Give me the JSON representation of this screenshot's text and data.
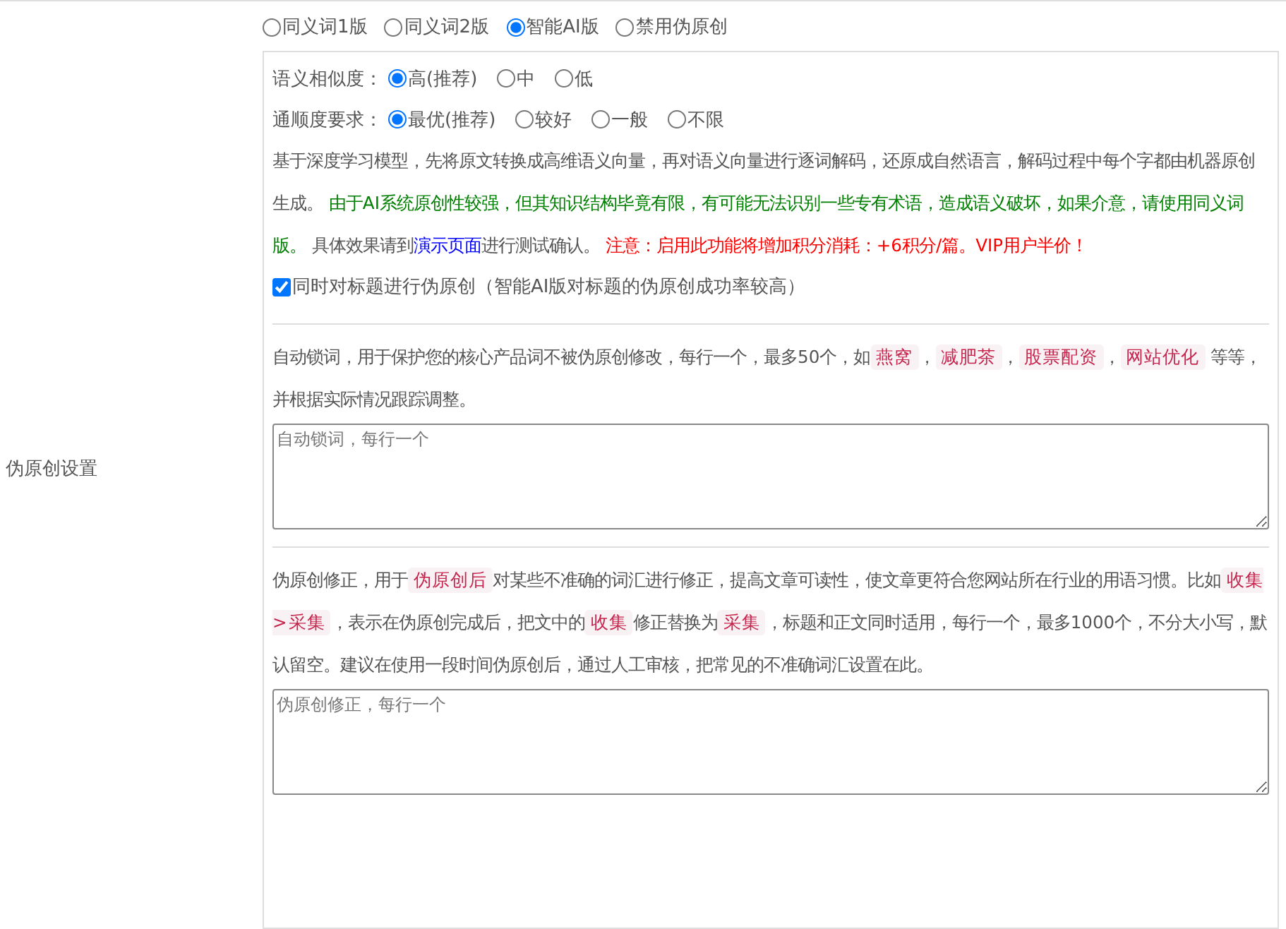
{
  "setting_label": "伪原创设置",
  "modes": [
    {
      "label": "同义词1版",
      "selected": false
    },
    {
      "label": "同义词2版",
      "selected": false
    },
    {
      "label": "智能AI版",
      "selected": true
    },
    {
      "label": "禁用伪原创",
      "selected": false
    }
  ],
  "similarity": {
    "label": "语义相似度：",
    "options": [
      {
        "label": "高(推荐)",
        "selected": true
      },
      {
        "label": "中",
        "selected": false
      },
      {
        "label": "低",
        "selected": false
      }
    ]
  },
  "fluency": {
    "label": "通顺度要求：",
    "options": [
      {
        "label": "最优(推荐)",
        "selected": true
      },
      {
        "label": "较好",
        "selected": false
      },
      {
        "label": "一般",
        "selected": false
      },
      {
        "label": "不限",
        "selected": false
      }
    ]
  },
  "ai_description": [
    {
      "kind": "plain",
      "text": "基于深度学习模型，先将原文转换成高维语义向量，再对语义向量进行逐词解码，还原成自然语言，解码过程中每个字都由机器原创生成。 "
    },
    {
      "kind": "green",
      "text": "由于AI系统原创性较强，但其知识结构毕竟有限，有可能无法识别一些专有术语，造成语义破坏，如果介意，请使用同义词版。"
    },
    {
      "kind": "plain",
      "text": " 具体效果请到"
    },
    {
      "kind": "link",
      "text": "演示页面"
    },
    {
      "kind": "plain",
      "text": "进行测试确认。 "
    },
    {
      "kind": "red",
      "text": "注意：启用此功能将增加积分消耗：+6积分/篇。VIP用户半价！"
    }
  ],
  "title_option": {
    "label": "同时对标题进行伪原创（智能AI版对标题的伪原创成功率较高）",
    "checked": true
  },
  "lock_words": {
    "description": [
      {
        "kind": "plain",
        "text": "自动锁词，用于保护您的核心产品词不被伪原创修改，每行一个，最多50个，如"
      },
      {
        "kind": "tag",
        "text": "燕窝"
      },
      {
        "kind": "plain",
        "text": "，"
      },
      {
        "kind": "tag",
        "text": "减肥茶"
      },
      {
        "kind": "plain",
        "text": "，"
      },
      {
        "kind": "tag",
        "text": "股票配资"
      },
      {
        "kind": "plain",
        "text": "，"
      },
      {
        "kind": "tag",
        "text": "网站优化"
      },
      {
        "kind": "plain",
        "text": " 等等，并根据实际情况跟踪调整。"
      }
    ],
    "placeholder": "自动锁词，每行一个"
  },
  "correction": {
    "description": [
      {
        "kind": "plain",
        "text": "伪原创修正，用于"
      },
      {
        "kind": "tag",
        "text": "伪原创后"
      },
      {
        "kind": "plain",
        "text": "对某些不准确的词汇进行修正，提高文章可读性，使文章更符合您网站所在行业的用语习惯。比如"
      },
      {
        "kind": "tag",
        "text": "收集>采集"
      },
      {
        "kind": "plain",
        "text": "，表示在伪原创完成后，把文中的"
      },
      {
        "kind": "tag",
        "text": "收集"
      },
      {
        "kind": "plain",
        "text": "修正替换为"
      },
      {
        "kind": "tag",
        "text": "采集"
      },
      {
        "kind": "plain",
        "text": "，标题和正文同时适用，每行一个，最多1000个，不分大小写，默认留空。建议在使用一段时间伪原创后，通过人工审核，把常见的不准确词汇设置在此。"
      }
    ],
    "placeholder": "伪原创修正，每行一个"
  }
}
